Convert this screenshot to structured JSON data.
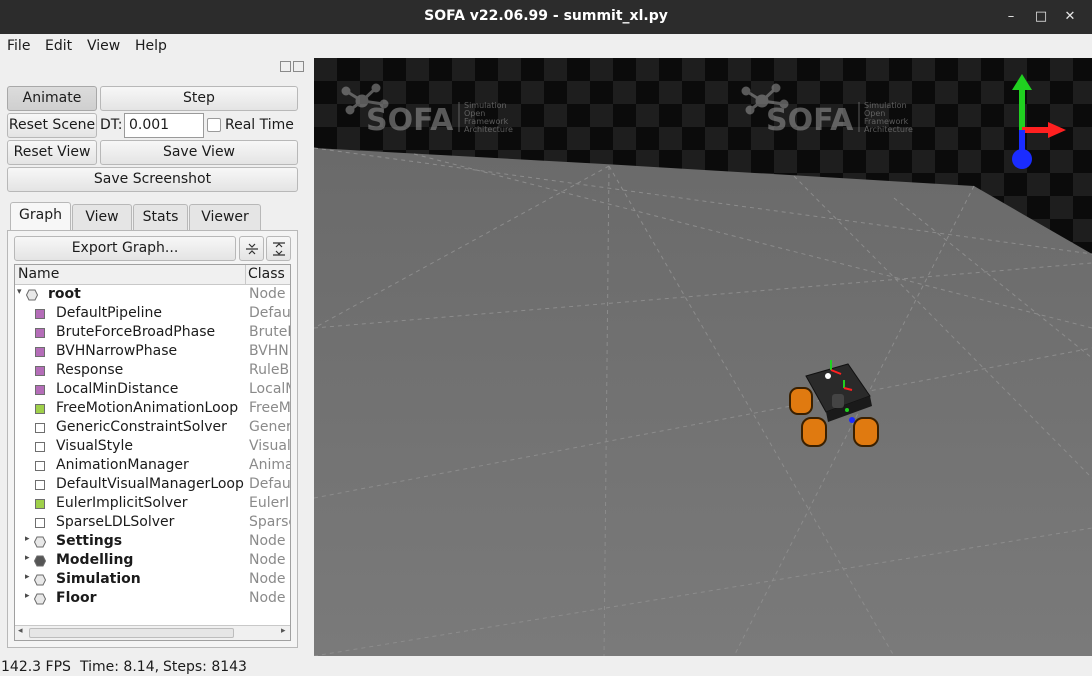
{
  "window": {
    "title": "SOFA v22.06.99 - summit_xl.py",
    "controls": [
      "minimize-icon",
      "maximize-icon",
      "close-icon"
    ]
  },
  "menu": {
    "items": [
      {
        "label": "File"
      },
      {
        "label": "Edit"
      },
      {
        "label": "View"
      },
      {
        "label": "Help"
      }
    ]
  },
  "controls": {
    "animate": "Animate",
    "step": "Step",
    "reset_scene": "Reset Scene",
    "dt_label": "DT:",
    "dt_value": "0.001",
    "real_time": "Real Time",
    "reset_view": "Reset View",
    "save_view": "Save View",
    "save_screenshot": "Save Screenshot"
  },
  "tabs": [
    {
      "label": "Graph",
      "active": true
    },
    {
      "label": "View"
    },
    {
      "label": "Stats"
    },
    {
      "label": "Viewer"
    }
  ],
  "graph": {
    "export_label": "Export Graph...",
    "collapse_icon": "collapse-all-icon",
    "expand_icon": "expand-all-icon",
    "columns": {
      "name": "Name",
      "class": "Class"
    },
    "rows": [
      {
        "name": "root",
        "class": "Node",
        "kind": "node",
        "bold": true,
        "expanded": true,
        "level": 0
      },
      {
        "name": "DefaultPipeline",
        "class": "Defau",
        "kind": "purple",
        "level": 1
      },
      {
        "name": "BruteForceBroadPhase",
        "class": "BruteF",
        "kind": "purple",
        "level": 1
      },
      {
        "name": "BVHNarrowPhase",
        "class": "BVHN",
        "kind": "purple",
        "level": 1
      },
      {
        "name": "Response",
        "class": "RuleB",
        "kind": "purple",
        "level": 1
      },
      {
        "name": "LocalMinDistance",
        "class": "LocalM",
        "kind": "purple",
        "level": 1
      },
      {
        "name": "FreeMotionAnimationLoop",
        "class": "FreeM",
        "kind": "green",
        "level": 1
      },
      {
        "name": "GenericConstraintSolver",
        "class": "Generic",
        "kind": "white",
        "level": 1
      },
      {
        "name": "VisualStyle",
        "class": "Visual",
        "kind": "white",
        "level": 1
      },
      {
        "name": "AnimationManager",
        "class": "Anima",
        "kind": "white",
        "level": 1
      },
      {
        "name": "DefaultVisualManagerLoop",
        "class": "Defau",
        "kind": "white",
        "level": 1
      },
      {
        "name": "EulerImplicitSolver",
        "class": "EulerIm",
        "kind": "green",
        "level": 1
      },
      {
        "name": "SparseLDLSolver",
        "class": "Sparse",
        "kind": "white",
        "level": 1
      },
      {
        "name": "Settings",
        "class": "Node",
        "kind": "node",
        "bold": true,
        "collapsed": true,
        "level": 1
      },
      {
        "name": "Modelling",
        "class": "Node",
        "kind": "node-dark",
        "bold": true,
        "collapsed": true,
        "level": 1
      },
      {
        "name": "Simulation",
        "class": "Node",
        "kind": "node",
        "bold": true,
        "collapsed": true,
        "level": 1
      },
      {
        "name": "Floor",
        "class": "Node",
        "kind": "node",
        "bold": true,
        "collapsed": true,
        "level": 1
      }
    ]
  },
  "viewport": {
    "logo_text": "SOFA",
    "logo_sub": [
      "Simulation",
      "Open",
      "Framework",
      "Architecture"
    ],
    "colors": {
      "floor": "#6f6f6f",
      "checker_dark": "#0b0b0b",
      "checker_light": "#1c1c1c",
      "axis_x": "#ff2020",
      "axis_y": "#20d020",
      "axis_z": "#1a2cff",
      "wheel": "#e07a10"
    }
  },
  "status": {
    "fps": "142.3 FPS",
    "time": "Time: 8.14,",
    "steps": "Steps:  8143"
  }
}
